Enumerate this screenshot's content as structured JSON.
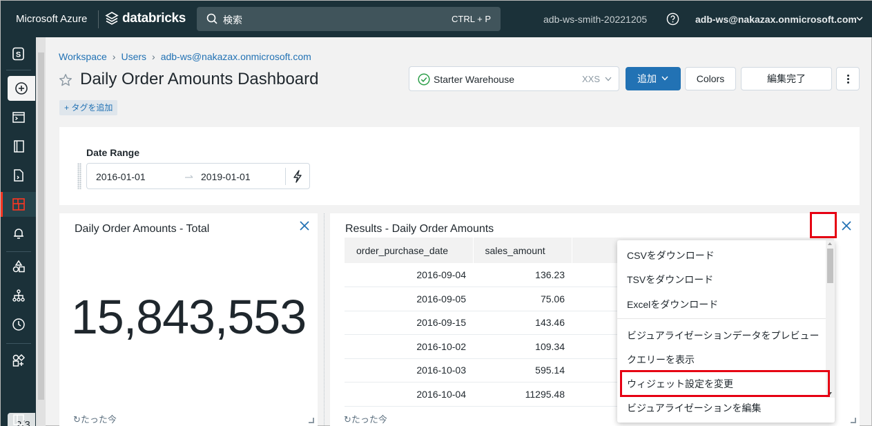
{
  "topbar": {
    "brand": "Microsoft Azure",
    "product": "databricks",
    "search_placeholder": "検索",
    "search_shortcut": "CTRL + P",
    "workspace": "adb-ws-smith-20221205",
    "user": "adb-ws@nakazax.onmicrosoft.com"
  },
  "leftnav": {
    "workspace_switcher": "S",
    "page_indicator": "2/3",
    "accent_color": "#ff3621"
  },
  "breadcrumb": [
    "Workspace",
    "Users",
    "adb-ws@nakazax.onmicrosoft.com"
  ],
  "page": {
    "title": "Daily Order Amounts Dashboard",
    "add_tag": "+ タグを追加"
  },
  "toolbar": {
    "warehouse_name": "Starter Warehouse",
    "warehouse_size": "XXS",
    "add_label": "追加",
    "colors_label": "Colors",
    "done_label": "編集完了"
  },
  "filter": {
    "label": "Date Range",
    "from": "2016-01-01",
    "to": "2019-01-01"
  },
  "widget_total": {
    "title": "Daily Order Amounts - Total",
    "value": "15,843,553",
    "footer": "たった今"
  },
  "widget_results": {
    "title": "Results - Daily Order Amounts",
    "columns": [
      "order_purchase_date",
      "sales_amount"
    ],
    "rows": [
      [
        "2016-09-04",
        "136.23"
      ],
      [
        "2016-09-05",
        "75.06"
      ],
      [
        "2016-09-15",
        "143.46"
      ],
      [
        "2016-10-02",
        "109.34"
      ],
      [
        "2016-10-03",
        "595.14"
      ],
      [
        "2016-10-04",
        "11295.48"
      ]
    ],
    "footer": "たった今"
  },
  "menu": {
    "items": [
      "CSVをダウンロード",
      "TSVをダウンロード",
      "Excelをダウンロード",
      "ビジュアライゼーションデータをプレビュー",
      "クエリーを表示",
      "ウィジェット設定を変更",
      "ビジュアライゼーションを編集"
    ],
    "highlighted_item": "ウィジェット設定を変更",
    "highlight_color": "#e60012"
  }
}
